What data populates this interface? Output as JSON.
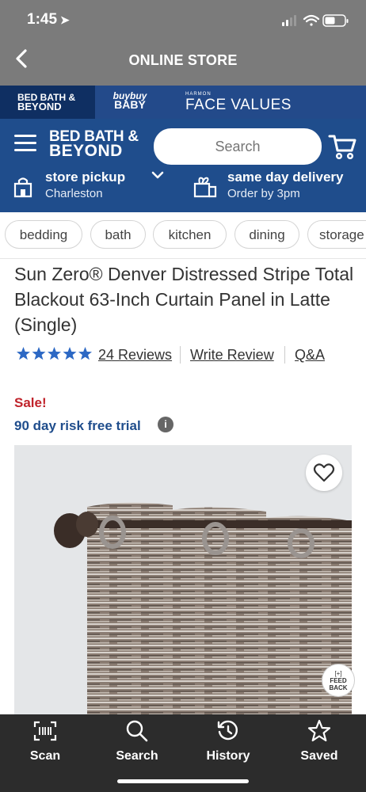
{
  "status_bar": {
    "time": "1:45"
  },
  "header": {
    "title": "ONLINE STORE"
  },
  "brands": [
    {
      "line1": "BED BATH &",
      "line2": "BEYOND"
    },
    {
      "line1": "buybuy",
      "line2": "BABY"
    },
    {
      "small": "HARMON",
      "big": "FACE VALUES"
    }
  ],
  "nav": {
    "logo_line1": "BED BATH &",
    "logo_line2": "BEYOND",
    "search_placeholder": "Search"
  },
  "pickup": {
    "title": "store pickup",
    "subtitle": "Charleston"
  },
  "sameday": {
    "title": "same day delivery",
    "subtitle": "Order by 3pm"
  },
  "categories": [
    "bedding",
    "bath",
    "kitchen",
    "dining",
    "storage"
  ],
  "product": {
    "title": "Sun Zero® Denver Distressed Stripe Total Blackout 63-Inch Curtain Panel in Latte (Single)",
    "rating": 5,
    "reviews_label": "24 Reviews",
    "write_review": "Write Review",
    "qa": "Q&A",
    "sale_label": "Sale!",
    "trial_label": "90 day risk free trial"
  },
  "feedback_label": "FEED BACK",
  "tabs": [
    {
      "label": "Scan",
      "icon": "scan-icon"
    },
    {
      "label": "Search",
      "icon": "search-icon"
    },
    {
      "label": "History",
      "icon": "history-icon"
    },
    {
      "label": "Saved",
      "icon": "star-icon"
    }
  ],
  "colors": {
    "header_gray": "#7b7b7b",
    "navy": "#0f2f62",
    "brand_blue": "#1f4d8c",
    "sale_red": "#c0232b",
    "star_blue": "#2c68c4",
    "tabbar": "#2c2c2c"
  }
}
